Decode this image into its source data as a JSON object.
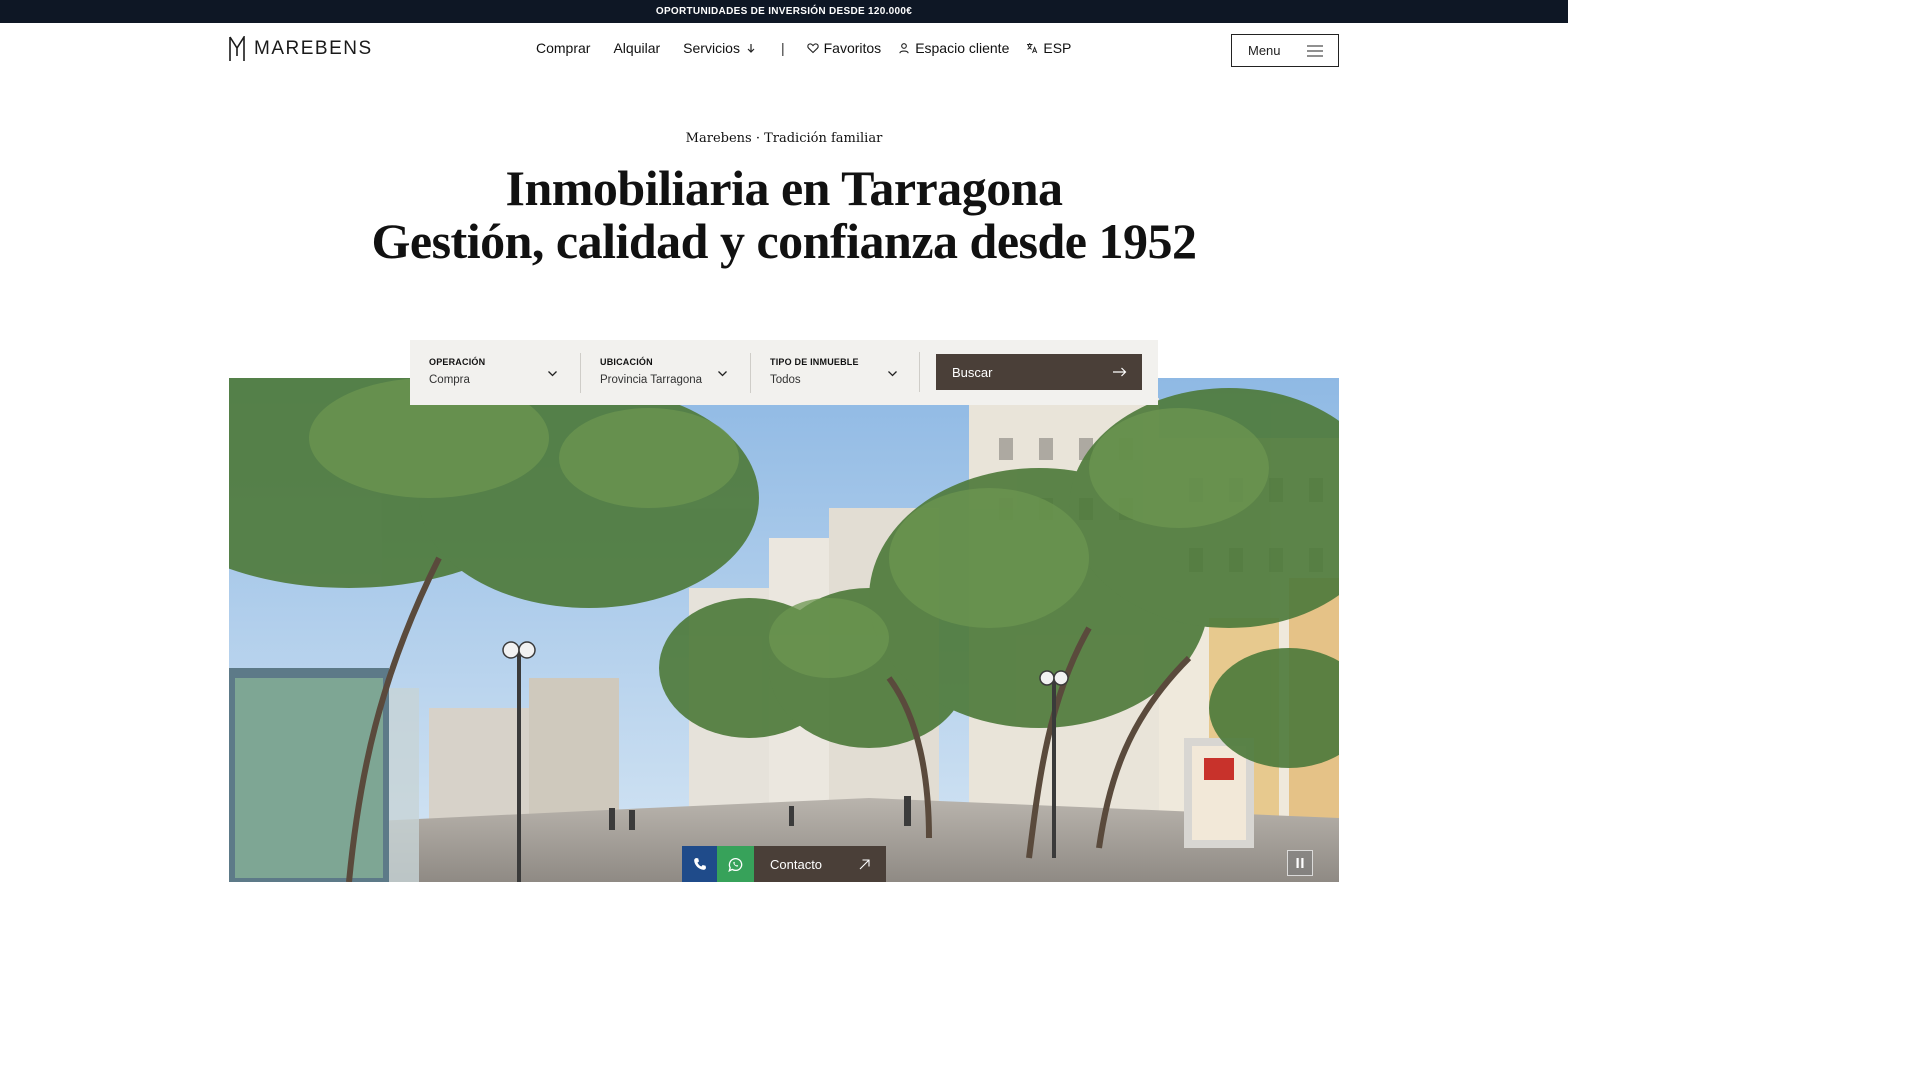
{
  "topbar": {
    "text": "OPORTUNIDADES DE INVERSIÓN DESDE 120.000€"
  },
  "brand": {
    "name": "MAREBENS"
  },
  "nav": {
    "buy": "Comprar",
    "rent": "Alquilar",
    "services": "Servicios",
    "separator": "|",
    "favorites": "Favoritos",
    "client_area": "Espacio cliente",
    "language": "ESP"
  },
  "menu": {
    "label": "Menu"
  },
  "hero": {
    "eyebrow": "Marebens · Tradición familiar",
    "line1": "Inmobiliaria en Tarragona",
    "line2": "Gestión, calidad y confianza desde 1952"
  },
  "search": {
    "operation": {
      "label": "OPERACIÓN",
      "value": "Compra"
    },
    "location": {
      "label": "UBICACIÓN",
      "value": "Provincia Tarragona"
    },
    "type": {
      "label": "TIPO DE INMUEBLE",
      "value": "Todos"
    },
    "button": "Buscar"
  },
  "contact": {
    "label": "Contacto"
  },
  "colors": {
    "topbar_bg": "#0e1725",
    "brand_brown": "#4a3f38",
    "phone_blue": "#1f4b8a",
    "whatsapp_green": "#37a25a",
    "search_panel_bg": "#f2f1ee"
  },
  "icons": [
    "logo-mark-icon",
    "arrow-down-icon",
    "heart-icon",
    "user-icon",
    "translate-icon",
    "hamburger-icon",
    "chevron-down-icon",
    "arrow-right-icon",
    "phone-icon",
    "whatsapp-icon",
    "arrow-up-right-icon",
    "pause-icon"
  ]
}
